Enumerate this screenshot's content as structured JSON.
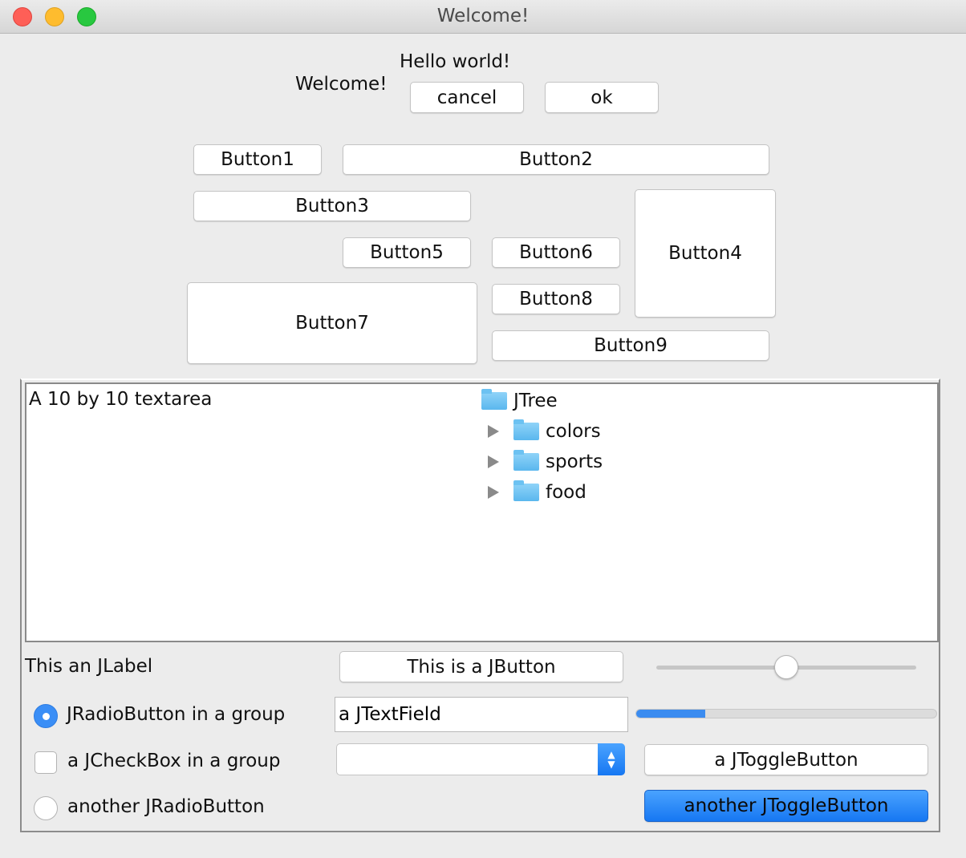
{
  "window": {
    "title": "Welcome!"
  },
  "header": {
    "hello": "Hello world!",
    "welcome": "Welcome!",
    "cancel": "cancel",
    "ok": "ok"
  },
  "buttons": {
    "b1": "Button1",
    "b2": "Button2",
    "b3": "Button3",
    "b4": "Button4",
    "b5": "Button5",
    "b6": "Button6",
    "b7": "Button7",
    "b8": "Button8",
    "b9": "Button9"
  },
  "textarea": {
    "text": "A 10 by 10 textarea"
  },
  "tree": {
    "root": "JTree",
    "children": [
      "colors",
      "sports",
      "food"
    ]
  },
  "controls": {
    "label": "This an JLabel",
    "button": "This is a JButton",
    "slider_value": 0.5,
    "progress_value": 0.23,
    "radio1": "JRadioButton in a group",
    "radio1_selected": true,
    "textfield_value": "a JTextField",
    "checkbox": "a JCheckBox in a group",
    "checkbox_checked": false,
    "combo_value": "",
    "toggle1": "a JToggleButton",
    "radio2": "another JRadioButton",
    "radio2_selected": false,
    "toggle2": "another JToggleButton",
    "toggle2_selected": true
  },
  "colors": {
    "accent": "#1677f2",
    "close": "#fe5f57",
    "minimize": "#febc2e",
    "maximize": "#28c840"
  }
}
